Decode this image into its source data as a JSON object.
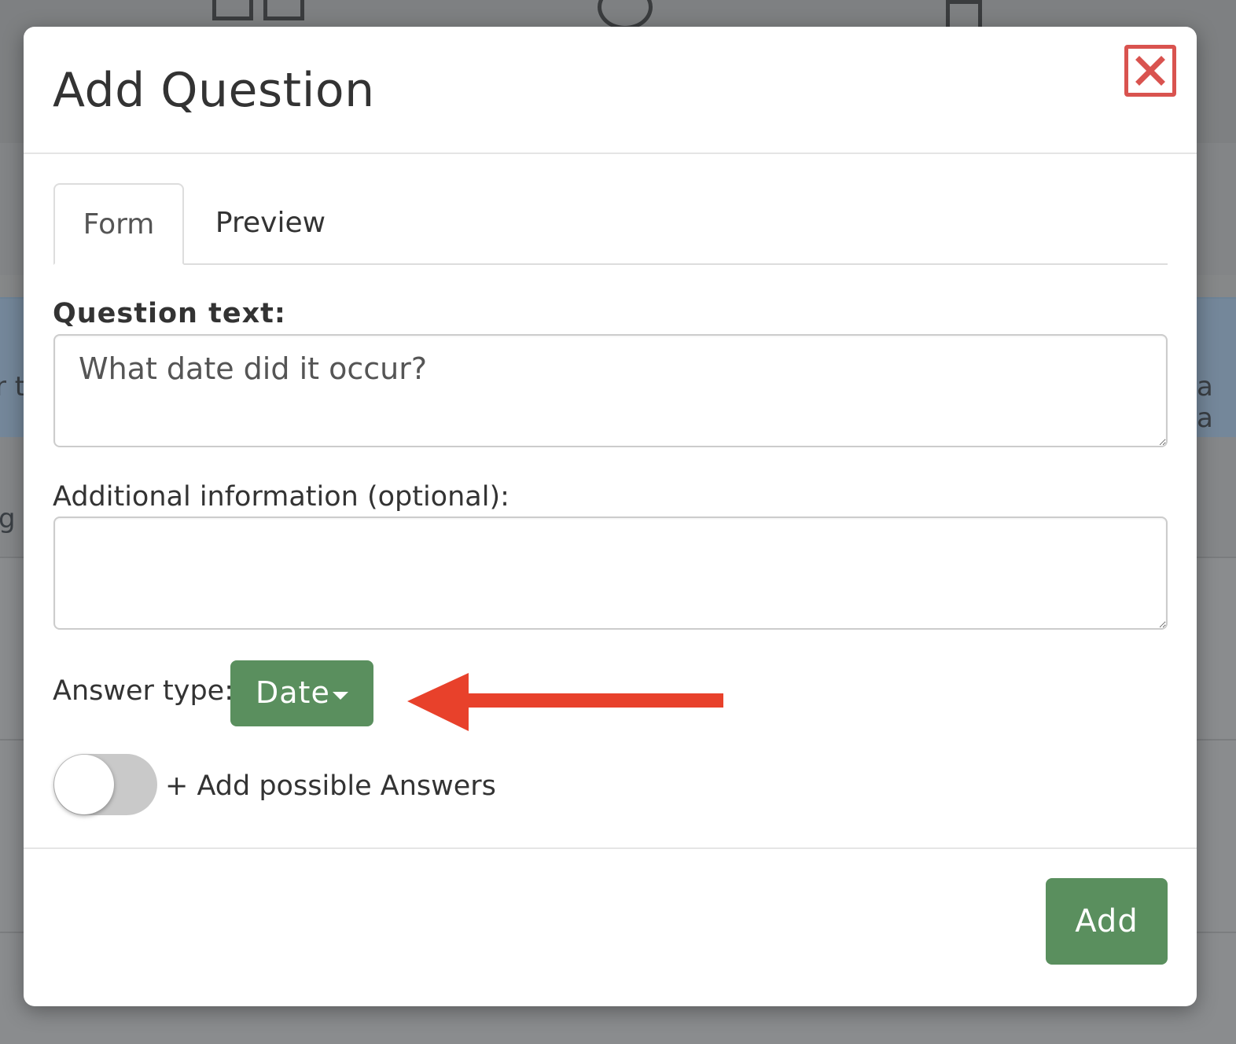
{
  "modal": {
    "title": "Add Question",
    "close_icon": "close-x-icon"
  },
  "tabs": [
    {
      "label": "Form",
      "active": true
    },
    {
      "label": "Preview",
      "active": false
    }
  ],
  "form": {
    "question_label": "Question text:",
    "question_value": "What date did it occur?",
    "additional_label": "Additional information (optional):",
    "additional_value": "",
    "answer_type_label": "Answer type:",
    "answer_type_value": "Date",
    "possible_answers_label": "+ Add possible Answers",
    "possible_answers_enabled": false
  },
  "footer": {
    "add_label": "Add"
  },
  "annotation": {
    "arrow_icon": "left-arrow-icon",
    "arrow_color": "#e8412b"
  },
  "colors": {
    "primary_green": "#5a8f5e",
    "close_red": "#d9534f",
    "overlay": "#7d7f81"
  },
  "background": {
    "fragments": [
      "r t",
      "a a",
      "g"
    ]
  }
}
